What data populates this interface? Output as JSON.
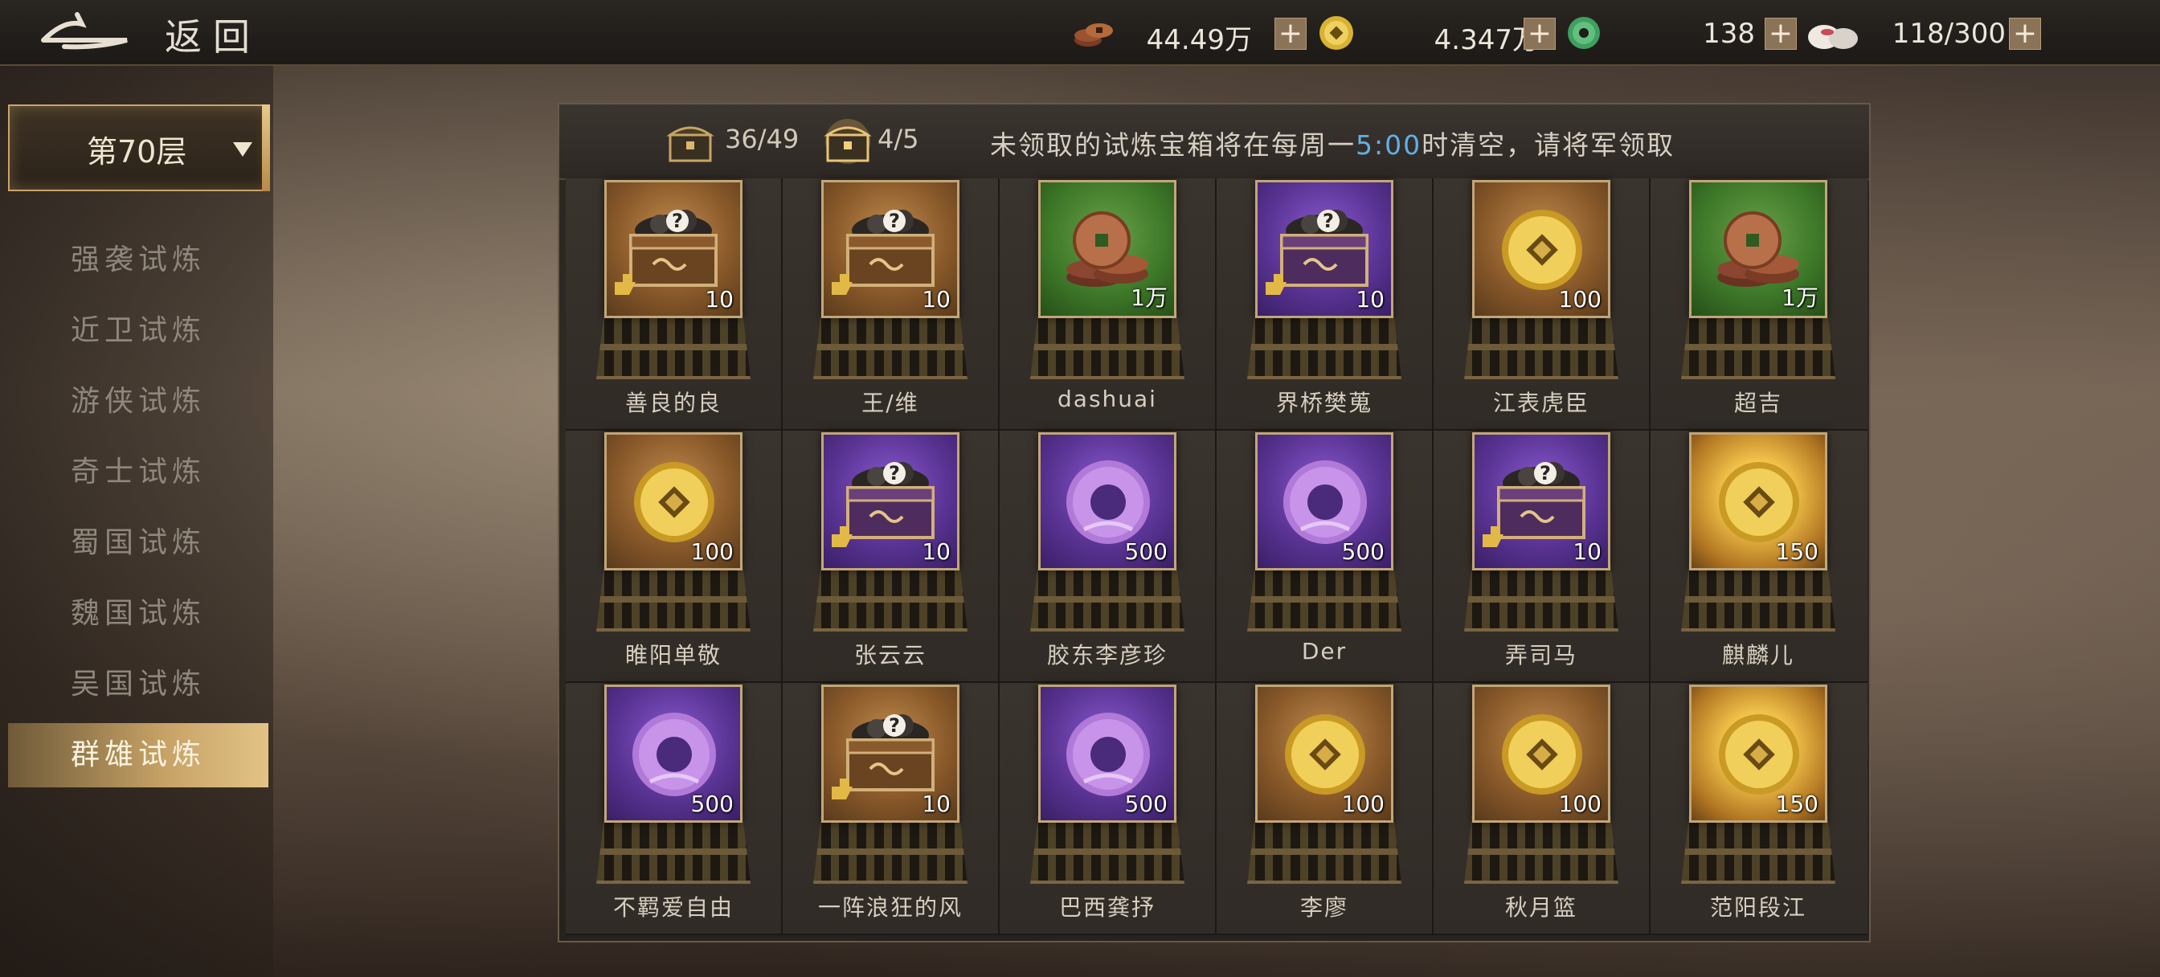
{
  "topbar": {
    "back_label": "返回",
    "resources": [
      {
        "icon": "copper-coins-icon",
        "value": "44.49万"
      },
      {
        "icon": "gold-ingot-icon",
        "value": "4.347万"
      },
      {
        "icon": "jade-disc-icon",
        "value": "138"
      },
      {
        "icon": "stamina-bun-icon",
        "value": "118/300"
      }
    ],
    "plus": "+"
  },
  "sidebar": {
    "floor": "第70层",
    "items": [
      {
        "label": "强袭试炼"
      },
      {
        "label": "近卫试炼"
      },
      {
        "label": "游侠试炼"
      },
      {
        "label": "奇士试炼"
      },
      {
        "label": "蜀国试炼"
      },
      {
        "label": "魏国试炼"
      },
      {
        "label": "吴国试炼"
      },
      {
        "label": "群雄试炼",
        "active": true
      }
    ]
  },
  "panel": {
    "chest_count_1": "36/49",
    "chest_count_2": "4/5",
    "notice_pre": "未领取的试炼宝箱将在每周一",
    "notice_time": "5:00",
    "notice_post": "时清空，请将军领取"
  },
  "rewards": [
    {
      "player": "善良的良",
      "type": "chest",
      "frame": "gold",
      "count": "10"
    },
    {
      "player": "王/维",
      "type": "chest",
      "frame": "gold",
      "count": "10"
    },
    {
      "player": "dashuai",
      "type": "copper",
      "frame": "green",
      "count": "1万"
    },
    {
      "player": "界桥樊蒐",
      "type": "chest",
      "frame": "purple",
      "count": "10"
    },
    {
      "player": "江表虎臣",
      "type": "gold",
      "frame": "gold",
      "count": "100"
    },
    {
      "player": "超吉",
      "type": "copper",
      "frame": "green",
      "count": "1万"
    },
    {
      "player": "睢阳单敬",
      "type": "gold",
      "frame": "gold",
      "count": "100"
    },
    {
      "player": "张云云",
      "type": "chest",
      "frame": "purple",
      "count": "10"
    },
    {
      "player": "胶东李彦珍",
      "type": "jade",
      "frame": "purple",
      "count": "500"
    },
    {
      "player": "Der",
      "type": "jade",
      "frame": "purple",
      "count": "500"
    },
    {
      "player": "弄司马",
      "type": "chest",
      "frame": "purple",
      "count": "10"
    },
    {
      "player": "麒麟儿",
      "type": "gold",
      "frame": "glow",
      "count": "150"
    },
    {
      "player": "不羁爱自由",
      "type": "jade",
      "frame": "purple",
      "count": "500"
    },
    {
      "player": "一阵浪狂的风",
      "type": "chest",
      "frame": "gold",
      "count": "10"
    },
    {
      "player": "巴西龚抒",
      "type": "jade",
      "frame": "purple",
      "count": "500"
    },
    {
      "player": "李廖",
      "type": "gold",
      "frame": "gold",
      "count": "100"
    },
    {
      "player": "秋月篮",
      "type": "gold",
      "frame": "gold",
      "count": "100"
    },
    {
      "player": "范阳段江",
      "type": "gold",
      "frame": "glow",
      "count": "150"
    }
  ]
}
